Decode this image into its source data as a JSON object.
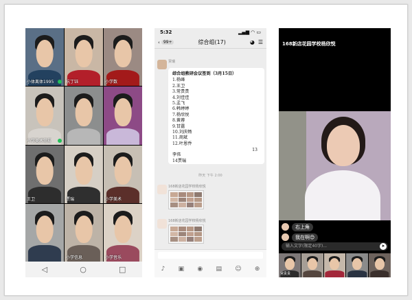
{
  "panel1": {
    "participants": [
      {
        "name": "小体离体1995",
        "bg": "#5a6f86",
        "shirt": "#23415f"
      },
      {
        "name": "杭丁钰",
        "bg": "#c9b7a5",
        "shirt": "#b31f2a"
      },
      {
        "name": "小学数",
        "bg": "#9b8a83",
        "shirt": "#a31a1a"
      },
      {
        "name": "小学美术常规",
        "bg": "#c8c3bb",
        "shirt": "#d8d4cf"
      },
      {
        "name": "",
        "bg": "#8c8e8e",
        "shirt": "#b7b7b7"
      },
      {
        "name": "",
        "bg": "#8d4a86",
        "shirt": "#c9b8d9"
      },
      {
        "name": "王卫",
        "bg": "#6f6f6f",
        "shirt": "#2d2d2d"
      },
      {
        "name": "贾瑞",
        "bg": "#d6cfc5",
        "shirt": "#2f2f2f"
      },
      {
        "name": "小学美术",
        "bg": "#c7bfb4",
        "shirt": "#5b2f2a"
      },
      {
        "name": "",
        "bg": "#a5a7a7",
        "shirt": "#2f3c4f"
      },
      {
        "name": "小学信息",
        "bg": "#bdb3a7",
        "shirt": "#6a5f58"
      },
      {
        "name": "小学音乐",
        "bg": "#dcd2c6",
        "shirt": "#9a4a5e"
      },
      {
        "name": "小学信息...",
        "bg": "#7a6c66",
        "shirt": "#3a2f2c"
      },
      {
        "name": "李",
        "bg": "#8a8a8a",
        "shirt": "#1f2c3d"
      }
    ],
    "nav": [
      "◁",
      "○",
      "□"
    ]
  },
  "panel2": {
    "time": "5:32",
    "status_icons": "▂▄▆ ◠ ▭",
    "back_count": "99+",
    "title": "综合组(17)",
    "header_icons": [
      "◕",
      "☰"
    ],
    "msg1_sender": "贾瑞",
    "notebook_title": "综合组教研会议签到（3月15日）",
    "notebook_lines": [
      "1.杨峰",
      "2.王卫",
      "3.常贵贵",
      "4.刘佳佳",
      "5.孟飞",
      "6.韩婷婷",
      "7.杨欣悦",
      "8.黄蓉",
      "9.甘露",
      "10.刘庆畅",
      "11.商斌",
      "12.叶恩乔"
    ],
    "notebook_sign": "13",
    "notebook_footer": [
      "李伟",
      "14贾瑞"
    ],
    "timestamp": "昨天 下午 2:00",
    "msg2_sender": "168新店花园学校杨欣悦",
    "msg3_sender": "168新店花园学校杨欣悦",
    "toolbar_icons": [
      "♪",
      "▣",
      "◉",
      "▤",
      "☺",
      "⊕"
    ]
  },
  "panel3": {
    "live_title": "168新店花园学校杨欣悦",
    "comments": [
      {
        "text": "右上角"
      },
      {
        "text": "我在啊😊"
      }
    ],
    "input_placeholder": "输入文字(限定40字)...",
    "send_icon": "➤",
    "strip": [
      {
        "name": "常贵贵",
        "bg": "#7e7878",
        "shirt": "#2c2c2c"
      },
      {
        "name": "",
        "bg": "#a69e96",
        "shirt": "#55463f"
      },
      {
        "name": "",
        "bg": "#c5b8aa",
        "shirt": "#a3273a"
      },
      {
        "name": "",
        "bg": "#8b8b8b",
        "shirt": "#2a3342"
      },
      {
        "name": "",
        "bg": "#6d625c",
        "shirt": "#3a2f2c"
      }
    ]
  }
}
